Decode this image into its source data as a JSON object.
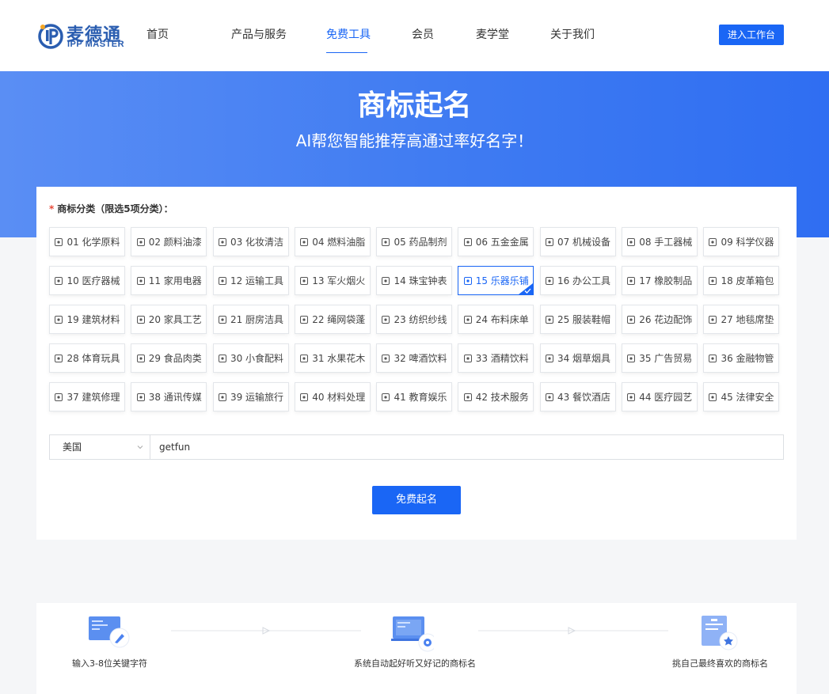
{
  "header": {
    "brand_cn": "麦德通",
    "brand_en": "IPP MASTER",
    "nav": [
      "首页",
      "产品与服务",
      "免费工具",
      "会员",
      "麦学堂",
      "关于我们"
    ],
    "active_nav": "免费工具",
    "workbench_button": "进入工作台"
  },
  "banner": {
    "title": "商标起名",
    "subtitle": "AI帮您智能推荐高通过率好名字！"
  },
  "form": {
    "required_mark": "*",
    "category_label": "商标分类（限选5项分类）：",
    "categories": [
      {
        "label": "01 化学原料",
        "icon": "flask-icon"
      },
      {
        "label": "02 颜料油漆",
        "icon": "paint-icon"
      },
      {
        "label": "03 化妆清洁",
        "icon": "cosmetic-icon"
      },
      {
        "label": "04 燃料油脂",
        "icon": "fuel-icon"
      },
      {
        "label": "05 药品制剂",
        "icon": "medicine-icon"
      },
      {
        "label": "06 五金金属",
        "icon": "metal-icon"
      },
      {
        "label": "07 机械设备",
        "icon": "machine-icon"
      },
      {
        "label": "08 手工器械",
        "icon": "tools-icon"
      },
      {
        "label": "09 科学仪器",
        "icon": "microscope-icon"
      },
      {
        "label": "10 医疗器械",
        "icon": "stethoscope-icon"
      },
      {
        "label": "11 家用电器",
        "icon": "appliance-icon"
      },
      {
        "label": "12 运输工具",
        "icon": "truck-icon"
      },
      {
        "label": "13 军火烟火",
        "icon": "firework-icon"
      },
      {
        "label": "14 珠宝钟表",
        "icon": "watch-icon"
      },
      {
        "label": "15 乐器乐铺",
        "icon": "guitar-icon"
      },
      {
        "label": "16 办公工具",
        "icon": "office-icon"
      },
      {
        "label": "17 橡胶制品",
        "icon": "rubber-icon"
      },
      {
        "label": "18 皮革箱包",
        "icon": "bag-icon"
      },
      {
        "label": "19 建筑材料",
        "icon": "building-icon"
      },
      {
        "label": "20 家具工艺",
        "icon": "furniture-icon"
      },
      {
        "label": "21 厨房洁具",
        "icon": "kitchen-icon"
      },
      {
        "label": "22 绳网袋蓬",
        "icon": "tent-icon"
      },
      {
        "label": "23 纺织纱线",
        "icon": "yarn-icon"
      },
      {
        "label": "24 布料床单",
        "icon": "fabric-icon"
      },
      {
        "label": "25 服装鞋帽",
        "icon": "clothing-icon"
      },
      {
        "label": "26 花边配饰",
        "icon": "button-icon"
      },
      {
        "label": "27 地毯席垫",
        "icon": "carpet-icon"
      },
      {
        "label": "28 体育玩具",
        "icon": "dumbbell-icon"
      },
      {
        "label": "29 食品肉类",
        "icon": "food-icon"
      },
      {
        "label": "30 小食配料",
        "icon": "snack-icon"
      },
      {
        "label": "31 水果花木",
        "icon": "plant-icon"
      },
      {
        "label": "32 啤酒饮料",
        "icon": "beer-icon"
      },
      {
        "label": "33 酒精饮料",
        "icon": "liquor-icon"
      },
      {
        "label": "34 烟草烟具",
        "icon": "tobacco-icon"
      },
      {
        "label": "35 广告贸易",
        "icon": "advert-icon"
      },
      {
        "label": "36 金融物管",
        "icon": "finance-icon"
      },
      {
        "label": "37 建筑修理",
        "icon": "repair-icon"
      },
      {
        "label": "38 通讯传媒",
        "icon": "phone-icon"
      },
      {
        "label": "39 运输旅行",
        "icon": "travel-icon"
      },
      {
        "label": "40 材料处理",
        "icon": "printer-icon"
      },
      {
        "label": "41 教育娱乐",
        "icon": "education-icon"
      },
      {
        "label": "42 技术服务",
        "icon": "tech-icon"
      },
      {
        "label": "43 餐饮酒店",
        "icon": "dining-icon"
      },
      {
        "label": "44 医疗园艺",
        "icon": "garden-icon"
      },
      {
        "label": "45 法律安全",
        "icon": "law-icon"
      }
    ],
    "selected_categories": [
      "15 乐器乐铺"
    ],
    "country": "美国",
    "keyword": "getfun",
    "submit_button": "免费起名"
  },
  "steps": [
    {
      "text": "输入3-8位关键字符",
      "icon": "keyboard-edit-icon"
    },
    {
      "text": "系统自动起好听又好记的商标名",
      "icon": "monitor-gear-icon"
    },
    {
      "text": "挑自己最终喜欢的商标名",
      "icon": "document-star-icon"
    }
  ],
  "colors": {
    "primary": "#1a66f5",
    "brand": "#2a5db0",
    "banner_start": "#5a8ef4",
    "banner_end": "#2f6ef2"
  }
}
